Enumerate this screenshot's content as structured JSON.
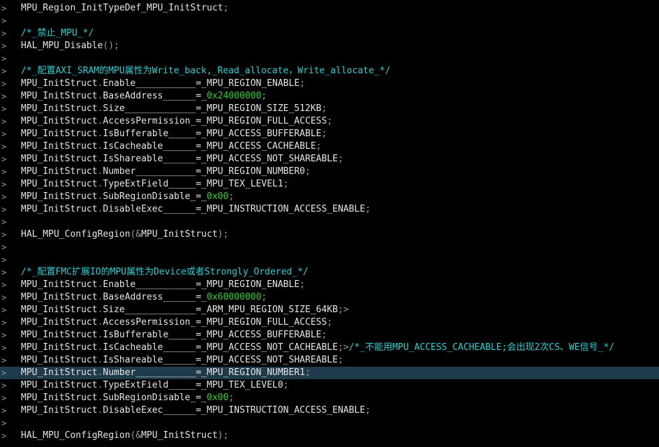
{
  "theme": {
    "background": "#000000",
    "text": "#e6e6e6",
    "comment": "#27d3d6",
    "number": "#2bd62b",
    "highlight_line": "#1f3a4a"
  },
  "gutter_icon": "fold-chevron-icon",
  "gutter_glyph": ">",
  "highlighted_line_index": 29,
  "lines": [
    [
      {
        "t": "text",
        "v": "MPU_Region_InitTypeDef_MPU_InitStruct"
      },
      {
        "t": "punct",
        "v": ";"
      }
    ],
    [],
    [
      {
        "t": "comment",
        "v": "/*_禁止_MPU_*/"
      }
    ],
    [
      {
        "t": "text",
        "v": "HAL_MPU_Disable"
      },
      {
        "t": "punct",
        "v": "();"
      }
    ],
    [],
    [
      {
        "t": "comment",
        "v": "/*_配置AXI_SRAM的MPU属性为Write_back,_Read_allocate，Write_allocate_*/"
      }
    ],
    [
      {
        "t": "text",
        "v": "MPU_InitStruct"
      },
      {
        "t": "dot",
        "v": "."
      },
      {
        "t": "text",
        "v": "Enable___________=_MPU_REGION_ENABLE"
      },
      {
        "t": "punct",
        "v": ";"
      }
    ],
    [
      {
        "t": "text",
        "v": "MPU_InitStruct"
      },
      {
        "t": "dot",
        "v": "."
      },
      {
        "t": "text",
        "v": "BaseAddress______=_"
      },
      {
        "t": "num",
        "v": "0x24000000"
      },
      {
        "t": "punct",
        "v": ";"
      }
    ],
    [
      {
        "t": "text",
        "v": "MPU_InitStruct"
      },
      {
        "t": "dot",
        "v": "."
      },
      {
        "t": "text",
        "v": "Size_____________=_MPU_REGION_SIZE_512KB"
      },
      {
        "t": "punct",
        "v": ";"
      }
    ],
    [
      {
        "t": "text",
        "v": "MPU_InitStruct"
      },
      {
        "t": "dot",
        "v": "."
      },
      {
        "t": "text",
        "v": "AccessPermission_=_MPU_REGION_FULL_ACCESS"
      },
      {
        "t": "punct",
        "v": ";"
      }
    ],
    [
      {
        "t": "text",
        "v": "MPU_InitStruct"
      },
      {
        "t": "dot",
        "v": "."
      },
      {
        "t": "text",
        "v": "IsBufferable_____=_MPU_ACCESS_BUFFERABLE"
      },
      {
        "t": "punct",
        "v": ";"
      }
    ],
    [
      {
        "t": "text",
        "v": "MPU_InitStruct"
      },
      {
        "t": "dot",
        "v": "."
      },
      {
        "t": "text",
        "v": "IsCacheable______=_MPU_ACCESS_CACHEABLE"
      },
      {
        "t": "punct",
        "v": ";"
      }
    ],
    [
      {
        "t": "text",
        "v": "MPU_InitStruct"
      },
      {
        "t": "dot",
        "v": "."
      },
      {
        "t": "text",
        "v": "IsShareable______=_MPU_ACCESS_NOT_SHAREABLE"
      },
      {
        "t": "punct",
        "v": ";"
      }
    ],
    [
      {
        "t": "text",
        "v": "MPU_InitStruct"
      },
      {
        "t": "dot",
        "v": "."
      },
      {
        "t": "text",
        "v": "Number___________=_MPU_REGION_NUMBER0"
      },
      {
        "t": "punct",
        "v": ";"
      }
    ],
    [
      {
        "t": "text",
        "v": "MPU_InitStruct"
      },
      {
        "t": "dot",
        "v": "."
      },
      {
        "t": "text",
        "v": "TypeExtField_____=_MPU_TEX_LEVEL1"
      },
      {
        "t": "punct",
        "v": ";"
      }
    ],
    [
      {
        "t": "text",
        "v": "MPU_InitStruct"
      },
      {
        "t": "dot",
        "v": "."
      },
      {
        "t": "text",
        "v": "SubRegionDisable_=_"
      },
      {
        "t": "num",
        "v": "0x00"
      },
      {
        "t": "punct",
        "v": ";"
      }
    ],
    [
      {
        "t": "text",
        "v": "MPU_InitStruct"
      },
      {
        "t": "dot",
        "v": "."
      },
      {
        "t": "text",
        "v": "DisableExec______=_MPU_INSTRUCTION_ACCESS_ENABLE"
      },
      {
        "t": "punct",
        "v": ";"
      }
    ],
    [],
    [
      {
        "t": "text",
        "v": "HAL_MPU_ConfigRegion"
      },
      {
        "t": "punct",
        "v": "("
      },
      {
        "t": "amp",
        "v": "&"
      },
      {
        "t": "text",
        "v": "MPU_InitStruct"
      },
      {
        "t": "punct",
        "v": ");"
      }
    ],
    [],
    [],
    [
      {
        "t": "comment",
        "v": "/*_配置FMC扩展IO的MPU属性为Device或者Strongly_Ordered_*/"
      }
    ],
    [
      {
        "t": "text",
        "v": "MPU_InitStruct"
      },
      {
        "t": "dot",
        "v": "."
      },
      {
        "t": "text",
        "v": "Enable___________=_MPU_REGION_ENABLE"
      },
      {
        "t": "punct",
        "v": ";"
      }
    ],
    [
      {
        "t": "text",
        "v": "MPU_InitStruct"
      },
      {
        "t": "dot",
        "v": "."
      },
      {
        "t": "text",
        "v": "BaseAddress______=_"
      },
      {
        "t": "num",
        "v": "0x60000000"
      },
      {
        "t": "punct",
        "v": ";"
      }
    ],
    [
      {
        "t": "text",
        "v": "MPU_InitStruct"
      },
      {
        "t": "dot",
        "v": "."
      },
      {
        "t": "text",
        "v": "Size_____________=_ARM_MPU_REGION_SIZE_64KB"
      },
      {
        "t": "punct",
        "v": ";>"
      }
    ],
    [
      {
        "t": "text",
        "v": "MPU_InitStruct"
      },
      {
        "t": "dot",
        "v": "."
      },
      {
        "t": "text",
        "v": "AccessPermission_=_MPU_REGION_FULL_ACCESS"
      },
      {
        "t": "punct",
        "v": ";"
      }
    ],
    [
      {
        "t": "text",
        "v": "MPU_InitStruct"
      },
      {
        "t": "dot",
        "v": "."
      },
      {
        "t": "text",
        "v": "IsBufferable_____=_MPU_ACCESS_BUFFERABLE"
      },
      {
        "t": "punct",
        "v": ";"
      }
    ],
    [
      {
        "t": "text",
        "v": "MPU_InitStruct"
      },
      {
        "t": "dot",
        "v": "."
      },
      {
        "t": "text",
        "v": "IsCacheable______=_MPU_ACCESS_NOT_CACHEABLE"
      },
      {
        "t": "punct",
        "v": ";>"
      },
      {
        "t": "comment",
        "v": "/*_不能用MPU_ACCESS_CACHEABLE;会出现2次CS、WE信号_*/"
      }
    ],
    [
      {
        "t": "text",
        "v": "MPU_InitStruct"
      },
      {
        "t": "dot",
        "v": "."
      },
      {
        "t": "text",
        "v": "IsShareable______=_MPU_ACCESS_NOT_SHAREABLE"
      },
      {
        "t": "punct",
        "v": ";"
      }
    ],
    [
      {
        "t": "text",
        "v": "MPU_InitStruct"
      },
      {
        "t": "dot",
        "v": "."
      },
      {
        "t": "text",
        "v": "Number___________=_MPU_REGION_NUMBER1"
      },
      {
        "t": "punct",
        "v": ";"
      }
    ],
    [
      {
        "t": "text",
        "v": "MPU_InitStruct"
      },
      {
        "t": "dot",
        "v": "."
      },
      {
        "t": "text",
        "v": "TypeExtField_____=_MPU_TEX_LEVEL0"
      },
      {
        "t": "punct",
        "v": ";"
      }
    ],
    [
      {
        "t": "text",
        "v": "MPU_InitStruct"
      },
      {
        "t": "dot",
        "v": "."
      },
      {
        "t": "text",
        "v": "SubRegionDisable_=_"
      },
      {
        "t": "num",
        "v": "0x00"
      },
      {
        "t": "punct",
        "v": ";"
      }
    ],
    [
      {
        "t": "text",
        "v": "MPU_InitStruct"
      },
      {
        "t": "dot",
        "v": "."
      },
      {
        "t": "text",
        "v": "DisableExec______=_MPU_INSTRUCTION_ACCESS_ENABLE"
      },
      {
        "t": "punct",
        "v": ";"
      }
    ],
    [],
    [
      {
        "t": "text",
        "v": "HAL_MPU_ConfigRegion"
      },
      {
        "t": "punct",
        "v": "("
      },
      {
        "t": "amp",
        "v": "&"
      },
      {
        "t": "text",
        "v": "MPU_InitStruct"
      },
      {
        "t": "punct",
        "v": ");"
      }
    ]
  ]
}
